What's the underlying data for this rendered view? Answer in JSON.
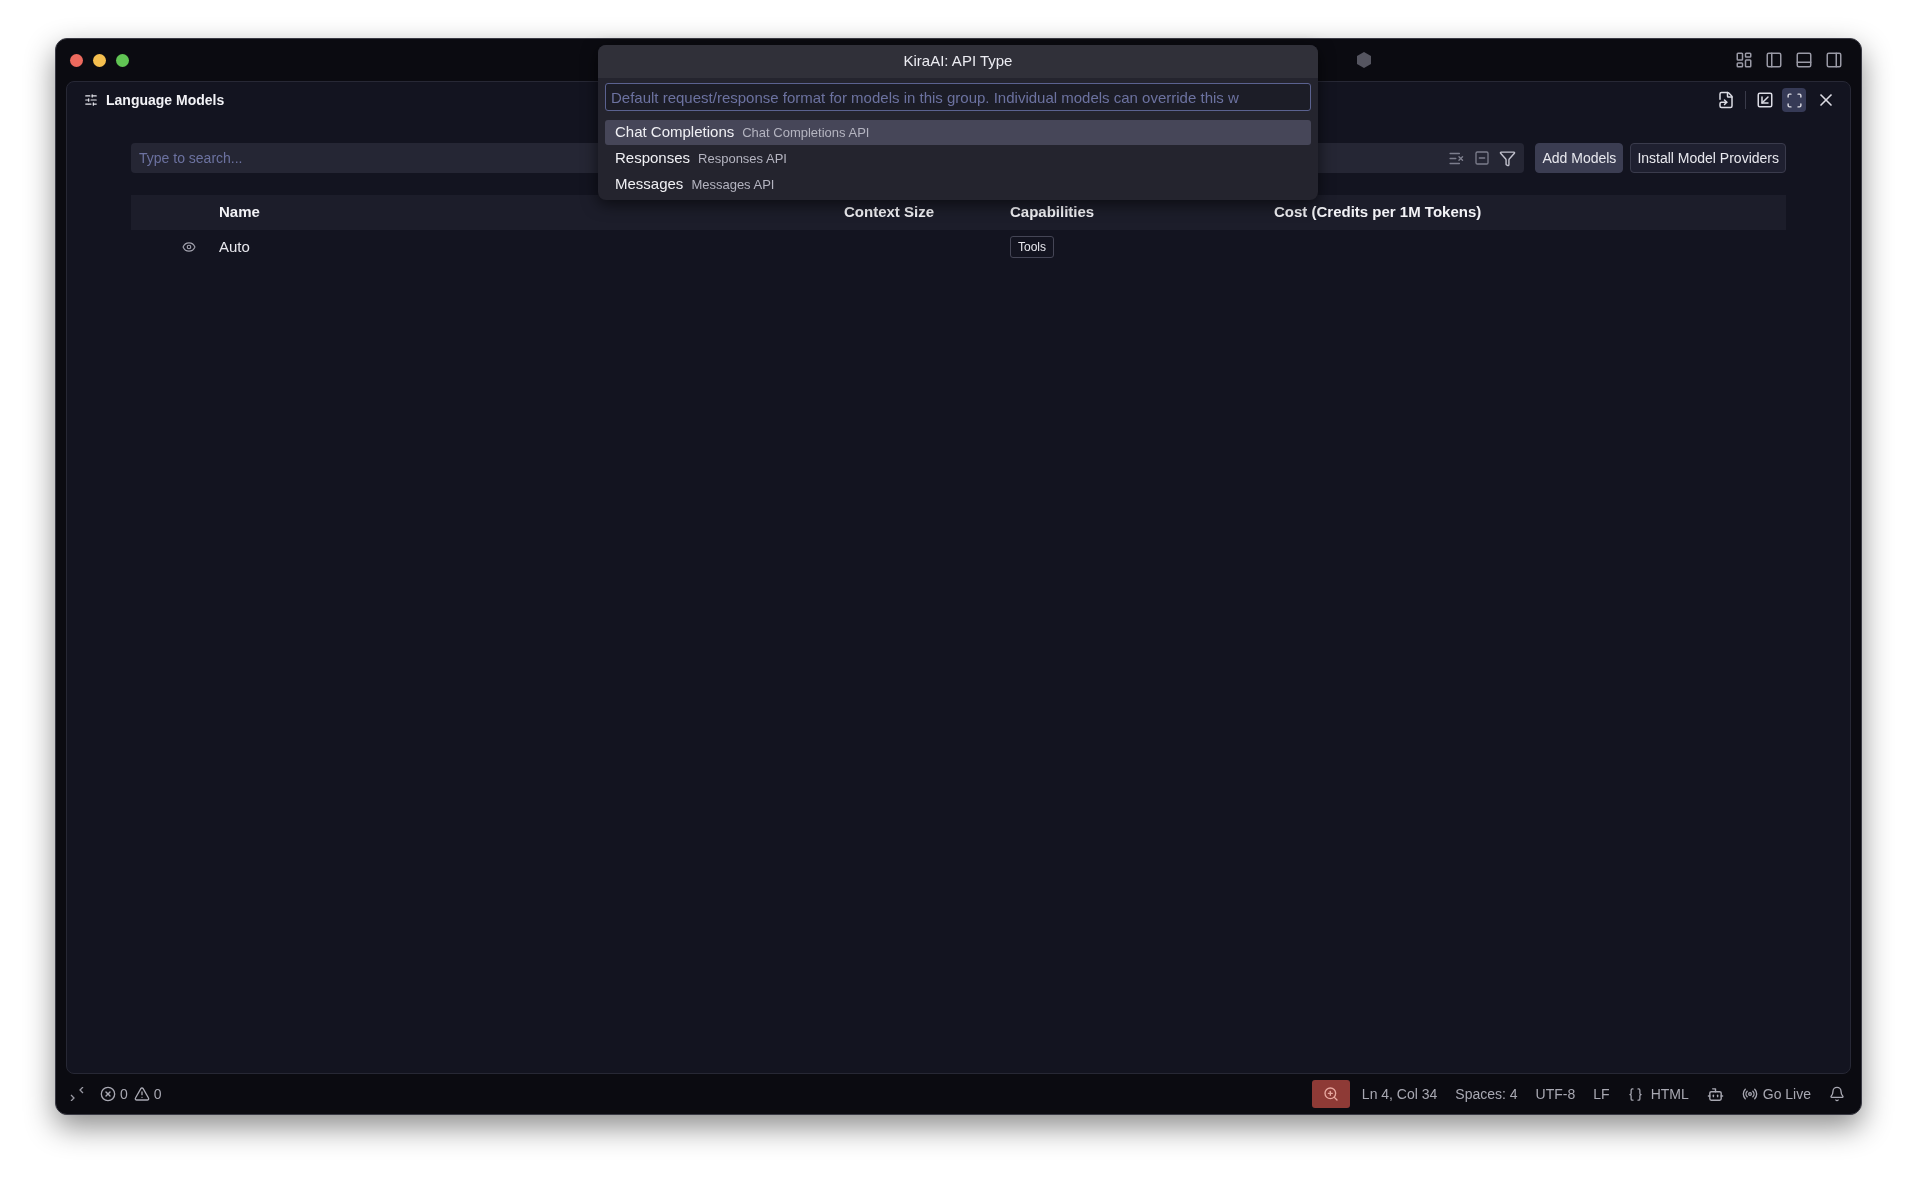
{
  "panel": {
    "title": "Language Models",
    "maximized": true
  },
  "search": {
    "placeholder": "Type to search..."
  },
  "buttons": [
    {
      "label": "Add Models",
      "kind": "primary"
    },
    {
      "label": "Install Model Providers",
      "kind": "secondary"
    }
  ],
  "table": {
    "columns": [
      "Name",
      "Context Size",
      "Capabilities",
      "Cost (Credits per 1M Tokens)"
    ],
    "rows": [
      {
        "name": "Auto",
        "capabilities": [
          "Tools"
        ]
      }
    ]
  },
  "quick_pick": {
    "title": "KiraAI: API Type",
    "placeholder": "Default request/response format for models in this group. Individual models can override this w",
    "items": [
      {
        "label": "Chat Completions",
        "description": "Chat Completions API",
        "selected": true
      },
      {
        "label": "Responses",
        "description": "Responses API",
        "selected": false
      },
      {
        "label": "Messages",
        "description": "Messages API",
        "selected": false
      }
    ]
  },
  "status_bar": {
    "errors": "0",
    "warnings": "0",
    "position": "Ln 4, Col 34",
    "indentation": "Spaces: 4",
    "encoding": "UTF-8",
    "line_ending": "LF",
    "language": "HTML",
    "go_live": "Go Live"
  }
}
